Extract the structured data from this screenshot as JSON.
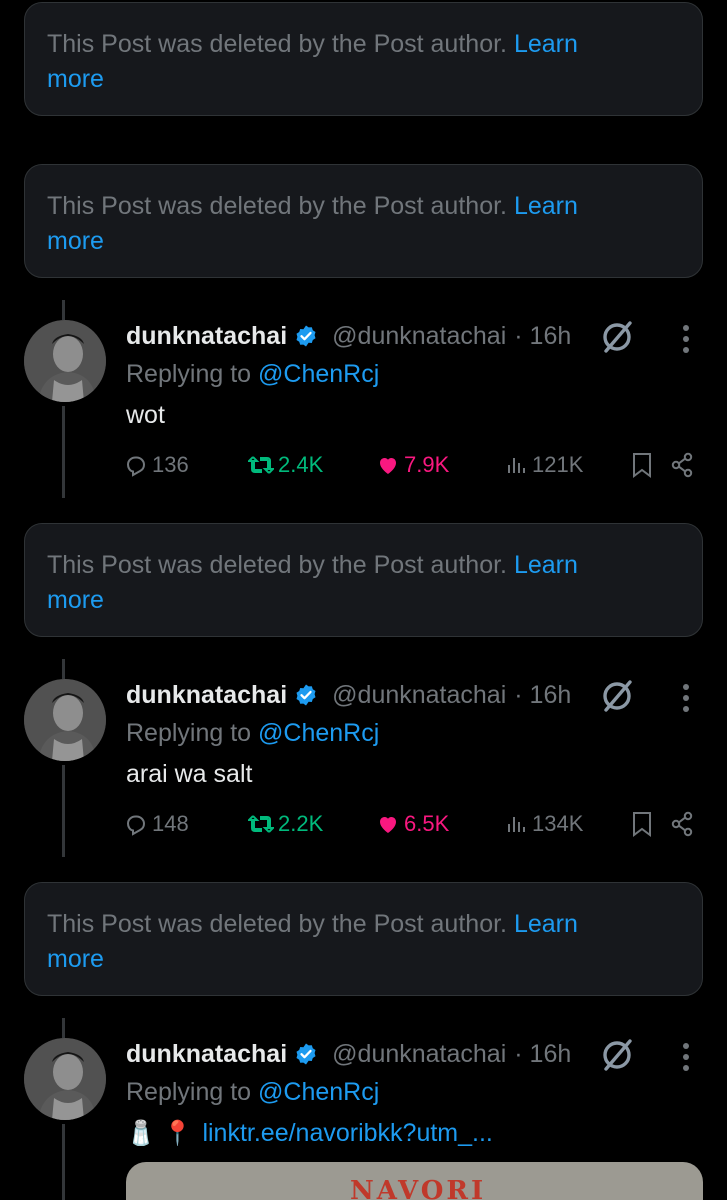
{
  "deleted_notice": {
    "text": "This Post was deleted by the Post author.",
    "link": "Learn",
    "link_more": "more"
  },
  "tweets": [
    {
      "name": "dunknatachai",
      "handle": "@dunknatachai",
      "time": "· 16h",
      "replying_prefix": "Replying to",
      "replying_to": "@ChenRcj",
      "text": "wot",
      "replies": "136",
      "reposts": "2.4K",
      "likes": "7.9K",
      "views": "121K"
    },
    {
      "name": "dunknatachai",
      "handle": "@dunknatachai",
      "time": "· 16h",
      "replying_prefix": "Replying to",
      "replying_to": "@ChenRcj",
      "text": "arai wa salt",
      "replies": "148",
      "reposts": "2.2K",
      "likes": "6.5K",
      "views": "134K"
    },
    {
      "name": "dunknatachai",
      "handle": "@dunknatachai",
      "time": "· 16h",
      "replying_prefix": "Replying to",
      "replying_to": "@ChenRcj",
      "emojis": "🧂 📍",
      "link": "linktr.ee/navoribkk?utm_...",
      "card_text": "NAVORI"
    }
  ],
  "icons": {
    "verified": "verified-badge-icon",
    "grok": "grok-icon",
    "more": "more-dots-icon",
    "reply": "reply-icon",
    "repost": "repost-icon",
    "like": "heart-icon",
    "views": "views-icon",
    "bookmark": "bookmark-icon",
    "share": "share-icon"
  },
  "colors": {
    "background": "#000000",
    "card": "#16181c",
    "muted": "#71767b",
    "accent": "#1d9bf0",
    "repost": "#00ba7c",
    "like": "#f91880"
  }
}
